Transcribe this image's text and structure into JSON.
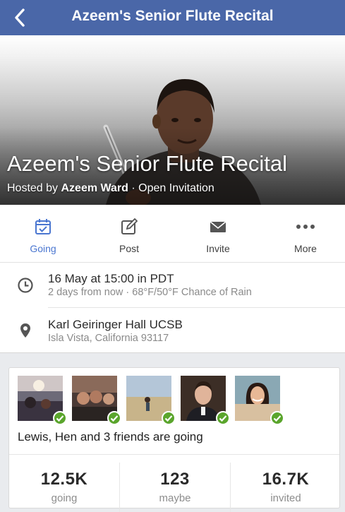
{
  "header": {
    "title": "Azeem's Senior Flute Recital",
    "back_icon": "chevron-left-icon"
  },
  "cover": {
    "event_title": "Azeem's Senior Flute Recital",
    "hosted_prefix": "Hosted by",
    "host_name": "Azeem Ward",
    "privacy": "· Open Invitation"
  },
  "actions": [
    {
      "label": "Going",
      "icon": "calendar-check-icon",
      "active": true
    },
    {
      "label": "Post",
      "icon": "compose-icon",
      "active": false
    },
    {
      "label": "Invite",
      "icon": "envelope-icon",
      "active": false
    },
    {
      "label": "More",
      "icon": "more-dots-icon",
      "active": false
    }
  ],
  "details": {
    "time": {
      "line1": "16 May at 15:00 in PDT",
      "line2": "2 days from now · 68°F/50°F Chance of Rain",
      "icon": "clock-icon"
    },
    "location": {
      "line1": "Karl Geiringer Hall UCSB",
      "line2": "Isla Vista, California 93117",
      "icon": "map-pin-icon"
    }
  },
  "friends": {
    "summary": "Lewis, Hen and 3 friends are going",
    "count_thumbnails": 5
  },
  "stats": [
    {
      "value": "12.5K",
      "label": "going"
    },
    {
      "value": "123",
      "label": "maybe"
    },
    {
      "value": "16.7K",
      "label": "invited"
    }
  ],
  "colors": {
    "header": "#4a67a8",
    "accent": "#4a76d0",
    "check": "#5aa52c"
  }
}
